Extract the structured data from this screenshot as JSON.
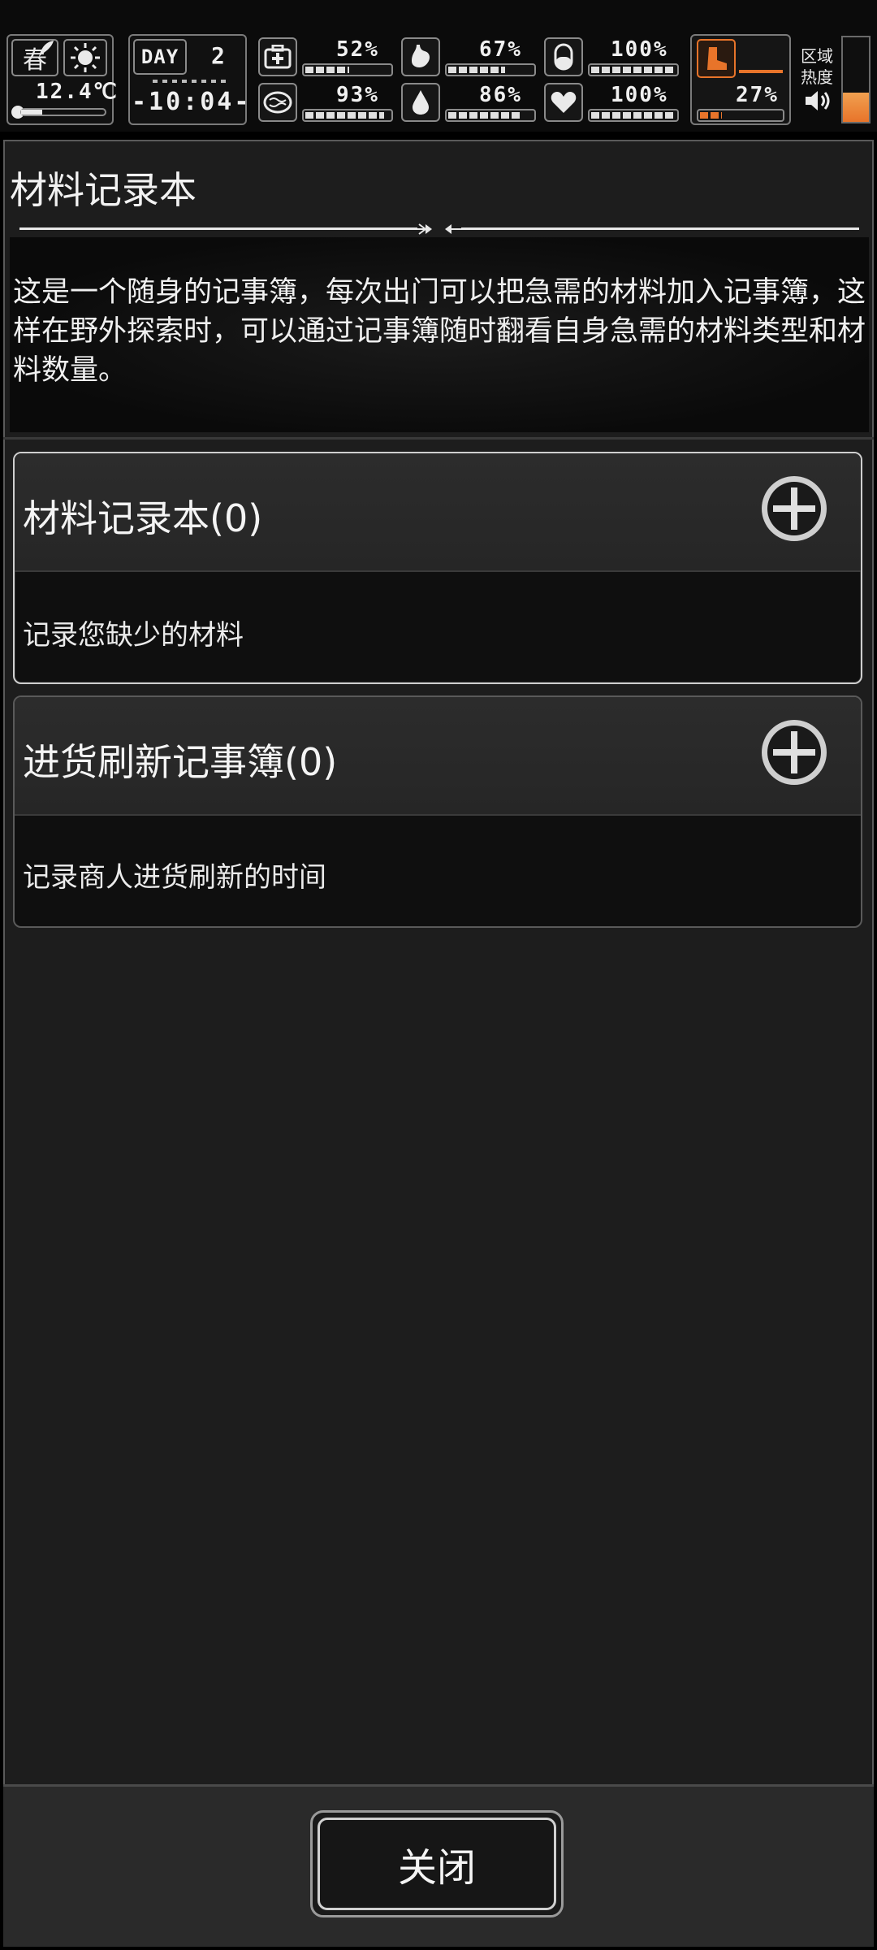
{
  "hud": {
    "season": "春",
    "temperature": "12.4℃",
    "day_label": "DAY",
    "day_number": "2",
    "clock": "-10:04-",
    "stats": [
      {
        "id": "health",
        "icon": "medkit-icon",
        "value": "52%",
        "level": 0.52
      },
      {
        "id": "hunger",
        "icon": "stomach-icon",
        "value": "67%",
        "level": 0.67
      },
      {
        "id": "medicine",
        "icon": "pill-icon",
        "value": "100%",
        "level": 1.0
      },
      {
        "id": "mood",
        "icon": "brain-icon",
        "value": "93%",
        "level": 0.93
      },
      {
        "id": "thirst",
        "icon": "water-drop-icon",
        "value": "86%",
        "level": 0.86
      },
      {
        "id": "heart",
        "icon": "heart-icon",
        "value": "100%",
        "level": 1.0
      }
    ],
    "stamina": {
      "icon": "boot-icon",
      "value": "27%",
      "level": 0.27
    },
    "zone_heat_label_1": "区域",
    "zone_heat_label_2": "热度",
    "zone_heat_level": 0.35
  },
  "panel": {
    "title": "材料记录本",
    "description": "这是一个随身的记事簿，每次出门可以把急需的材料加入记事簿，这样在野外探索时，可以通过记事簿随时翻看自身急需的材料类型和材料数量。",
    "cards": [
      {
        "title": "材料记录本(0)",
        "subtitle": "记录您缺少的材料"
      },
      {
        "title": "进货刷新记事簿(0)",
        "subtitle": "记录商人进货刷新的时间"
      }
    ],
    "close_label": "关闭"
  },
  "colors": {
    "accent_orange": "#e8742a",
    "panel_bg": "#1d1d1d"
  }
}
